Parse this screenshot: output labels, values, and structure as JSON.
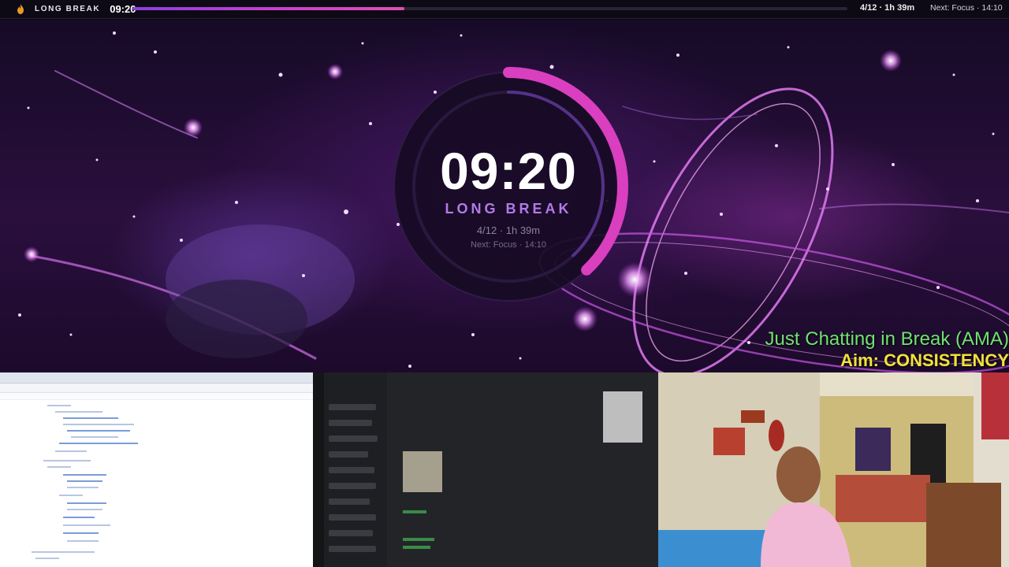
{
  "topbar": {
    "logo_icon": "flame-icon",
    "mode": "LONG BREAK",
    "time": "09:20",
    "progress": 0.38,
    "stats": "4/12 · 1h 39m",
    "next": "Next: Focus · 14:10"
  },
  "timer": {
    "time": "09:20",
    "mode": "LONG BREAK",
    "stats": "4/12 · 1h 39m",
    "next": "Next: Focus · 14:10",
    "progress": 0.38
  },
  "overlay": {
    "line1": "Just Chatting in Break (AMA)",
    "line2": "Aim: CONSISTENCY"
  },
  "colors": {
    "accent": "#c53fd1",
    "accent_pink": "#e04fb2",
    "overlay_green": "#6fe36f",
    "overlay_yellow": "#f3e23a"
  }
}
